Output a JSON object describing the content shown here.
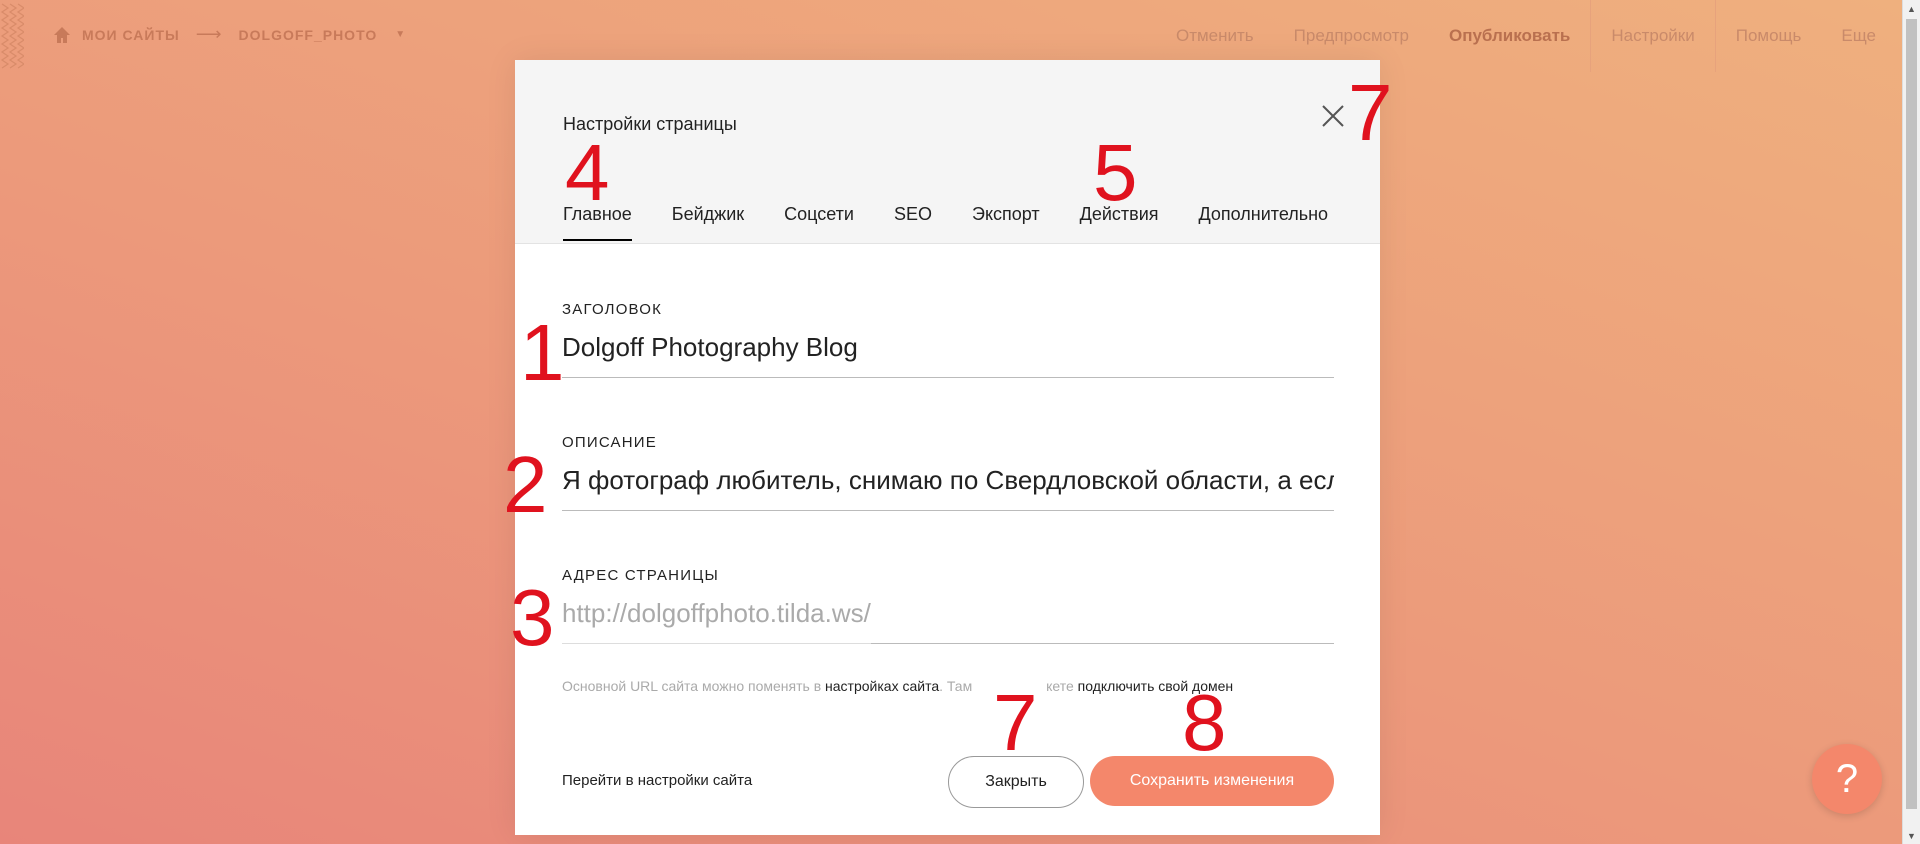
{
  "topbar": {
    "breadcrumb": {
      "my_sites": "МОИ САЙТЫ",
      "arrow": "⟶",
      "project": "DOLGOFF_PHOTO",
      "caret": "▼"
    },
    "nav": [
      "Отменить",
      "Предпросмотр",
      "Опубликовать",
      "Настройки",
      "Помощь",
      "Еще"
    ]
  },
  "modal": {
    "title": "Настройки страницы",
    "tabs": [
      "Главное",
      "Бейджик",
      "Соцсети",
      "SEO",
      "Экспорт",
      "Действия",
      "Дополнительно"
    ],
    "fields": {
      "title_label": "ЗАГОЛОВОК",
      "title_value": "Dolgoff Photography Blog",
      "desc_label": "ОПИСАНИЕ",
      "desc_value": "Я фотограф любитель, снимаю по Свердловской области, а если ес",
      "url_label": "АДРЕС СТРАНИЦЫ",
      "url_placeholder": "http://dolgoffphoto.tilda.ws/"
    },
    "hint": {
      "part1": "Основной URL сайта можно поменять в ",
      "link1": "настройках сайта",
      "part2": ". Там ",
      "part3": "кете ",
      "link2": "подключить свой домен"
    },
    "footer": {
      "site_settings_link": "Перейти в настройки сайта",
      "close_button": "Закрыть",
      "save_button": "Сохранить изменения"
    }
  },
  "annotations": [
    "1",
    "2",
    "3",
    "4",
    "5",
    "7",
    "7",
    "8"
  ],
  "help_button": "?",
  "colors": {
    "accent": "#f4876b",
    "annotation": "#e0121e"
  }
}
